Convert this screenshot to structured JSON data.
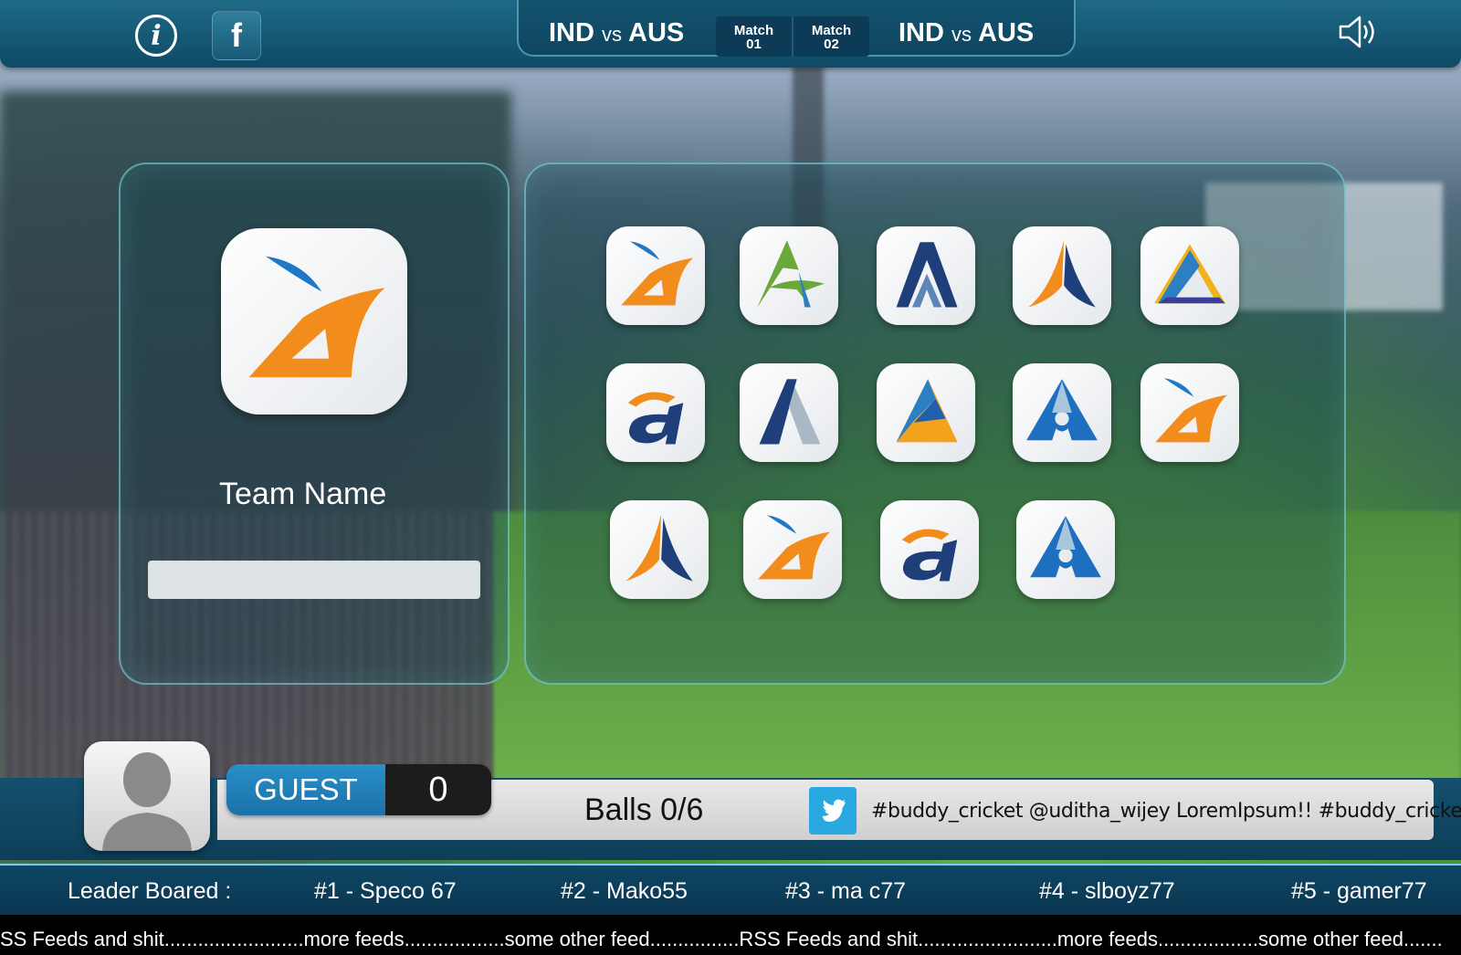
{
  "header": {
    "match_left": {
      "team_a": "IND",
      "vs": "vs",
      "team_b": "AUS"
    },
    "match_right": {
      "team_a": "IND",
      "vs": "vs",
      "team_b": "AUS"
    },
    "tabs": [
      {
        "label": "Match",
        "number": "01"
      },
      {
        "label": "Match",
        "number": "02"
      }
    ],
    "info_icon": "info-icon",
    "facebook_icon": "facebook-icon",
    "facebook_glyph": "f",
    "info_glyph": "i",
    "sound_icon": "speaker-icon"
  },
  "team_panel": {
    "label": "Team Name",
    "input_value": "",
    "selected_logo": "orange-blue-swoosh-logo"
  },
  "logo_grid": {
    "count": 14,
    "logos": [
      "orange-blue-swoosh-logo",
      "green-a-logo",
      "navy-a-logo",
      "orange-navy-a-logo",
      "gold-blue-a-logo",
      "orange-navy-lowercase-a-logo",
      "navy-grey-a-logo",
      "blue-orange-triangle-logo",
      "blue-keyhole-a-logo",
      "orange-blue-swoosh-logo",
      "orange-navy-a-logo",
      "orange-blue-swoosh-logo",
      "orange-navy-lowercase-a-logo",
      "blue-keyhole-a-logo"
    ]
  },
  "player": {
    "avatar_icon": "user-silhouette-icon",
    "name": "GUEST",
    "score": "0",
    "balls": "Balls 0/6"
  },
  "twitter": {
    "icon": "twitter-icon",
    "feed": "#buddy_cricket  @uditha_wijey  LoremIpsum!! #buddy_cricket"
  },
  "leaderboard": {
    "label": "Leader Boared :",
    "entries": [
      "#1 - Speco 67",
      "#2 - Mako55",
      "#3 - ma c77",
      "#4 - slboyz77",
      "#5 - gamer77"
    ]
  },
  "rss": {
    "text": "SS Feeds and shit.........................more feeds..................some other feed................RSS Feeds and shit.........................more feeds..................some other feed......."
  },
  "colors": {
    "header_blue": "#0f4a66",
    "guest_blue": "#1b71a8",
    "twitter_blue": "#29a9e0",
    "accent_orange": "#f08a1e",
    "navy": "#1f3f7a"
  }
}
